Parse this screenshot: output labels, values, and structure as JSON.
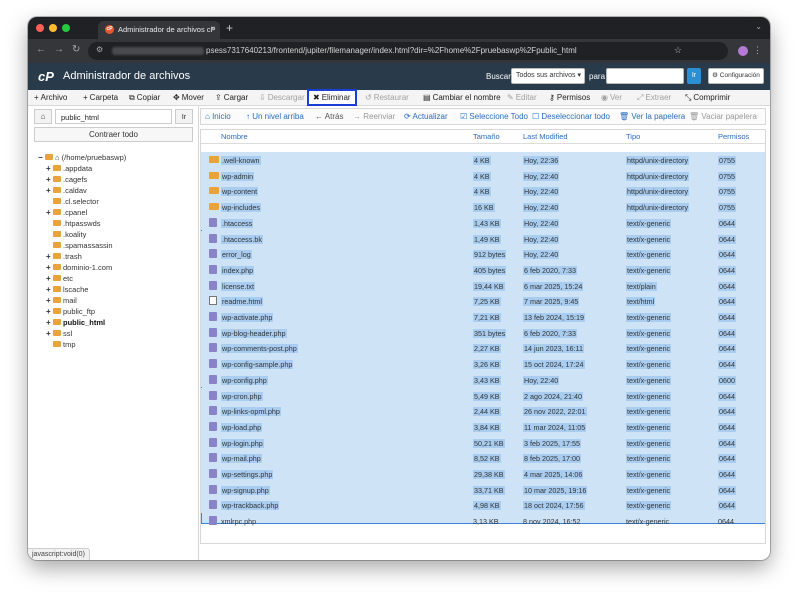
{
  "browser": {
    "tab_title": "Administrador de archivos cP",
    "url_text": "psess7317640213/frontend/jupiter/filemanager/index.html?dir=%2Fhome%2Fpruebaswp%2Fpublic_html",
    "newtab_label": "+",
    "tab_close": "×"
  },
  "header": {
    "logo": "cP",
    "title": "Administrador de archivos",
    "search_label": "Buscar",
    "search_scope": "Todos sus archivos",
    "for_label": "para",
    "search_value": "",
    "go_label": "Ir",
    "settings_label": "Configuración"
  },
  "toolbar": {
    "items": [
      {
        "label": "Archivo",
        "icon": "plus-icon",
        "glyph": "+"
      },
      {
        "label": "Carpeta",
        "icon": "plus-icon",
        "glyph": "+"
      },
      {
        "label": "Copiar",
        "icon": "copy-icon",
        "glyph": "⧉"
      },
      {
        "label": "Mover",
        "icon": "move-icon",
        "glyph": "✥"
      },
      {
        "label": "Cargar",
        "icon": "upload-icon",
        "glyph": "⇪"
      },
      {
        "label": "Descargar",
        "icon": "download-icon",
        "glyph": "⇩"
      },
      {
        "label": "Eliminar",
        "icon": "delete-icon",
        "glyph": "✖"
      },
      {
        "label": "Restaurar",
        "icon": "restore-icon",
        "glyph": "↺"
      },
      {
        "label": "Cambiar el nombre",
        "icon": "rename-icon",
        "glyph": "▤"
      },
      {
        "label": "Editar",
        "icon": "edit-icon",
        "glyph": "✎"
      },
      {
        "label": "Permisos",
        "icon": "key-icon",
        "glyph": "⚷"
      },
      {
        "label": "Ver",
        "icon": "eye-icon",
        "glyph": "◉"
      },
      {
        "label": "Extraer",
        "icon": "extract-icon",
        "glyph": "⤢"
      },
      {
        "label": "Comprimir",
        "icon": "compress-icon",
        "glyph": "⤡"
      }
    ]
  },
  "sidebar": {
    "path_value": "public_html",
    "go_label": "Ir",
    "collapse_label": "Contraer todo",
    "root_label": "(/home/pruebaswp)",
    "tree": [
      {
        "label": ".appdata",
        "expandable": true
      },
      {
        "label": ".cagefs",
        "expandable": true
      },
      {
        "label": ".caldav",
        "expandable": true
      },
      {
        "label": ".cl.selector",
        "expandable": false
      },
      {
        "label": ".cpanel",
        "expandable": true
      },
      {
        "label": ".htpasswds",
        "expandable": false
      },
      {
        "label": ".koality",
        "expandable": false
      },
      {
        "label": ".spamassassin",
        "expandable": false
      },
      {
        "label": ".trash",
        "expandable": true
      },
      {
        "label": "dominio-1.com",
        "expandable": true
      },
      {
        "label": "etc",
        "expandable": true
      },
      {
        "label": "lscache",
        "expandable": true
      },
      {
        "label": "mail",
        "expandable": true
      },
      {
        "label": "public_ftp",
        "expandable": true
      },
      {
        "label": "public_html",
        "expandable": true,
        "bold": true
      },
      {
        "label": "ssl",
        "expandable": true
      },
      {
        "label": "tmp",
        "expandable": false
      }
    ]
  },
  "nav": {
    "items": [
      {
        "label": "Inicio",
        "glyph": "⌂"
      },
      {
        "label": "Un nivel arriba",
        "glyph": "↑"
      },
      {
        "label": "Atrás",
        "glyph": "←"
      },
      {
        "label": "Reenviar",
        "glyph": "→"
      },
      {
        "label": "Actualizar",
        "glyph": "⟳"
      },
      {
        "label": "Seleccione Todo",
        "glyph": "☑"
      },
      {
        "label": "Deseleccionar todo",
        "glyph": "☐"
      },
      {
        "label": "Ver la papelera",
        "glyph": "🗑"
      },
      {
        "label": "Vaciar papelera",
        "glyph": "🗑"
      }
    ]
  },
  "listing": {
    "columns": [
      "Nombre",
      "Tamaño",
      "Last Modified",
      "Tipo",
      "Permisos"
    ],
    "rows": [
      {
        "name": ".well-known",
        "size": "4 KB",
        "modified": "Hoy, 22:36",
        "type": "httpd/unix-directory",
        "perms": "0755",
        "kind": "folder"
      },
      {
        "name": "wp-admin",
        "size": "4 KB",
        "modified": "Hoy, 22:40",
        "type": "httpd/unix-directory",
        "perms": "0755",
        "kind": "folder"
      },
      {
        "name": "wp-content",
        "size": "4 KB",
        "modified": "Hoy, 22:40",
        "type": "httpd/unix-directory",
        "perms": "0755",
        "kind": "folder"
      },
      {
        "name": "wp-includes",
        "size": "16 KB",
        "modified": "Hoy, 22:40",
        "type": "httpd/unix-directory",
        "perms": "0755",
        "kind": "folder"
      },
      {
        "name": ".htaccess",
        "size": "1,43 KB",
        "modified": "Hoy, 22:40",
        "type": "text/x-generic",
        "perms": "0644",
        "kind": "file"
      },
      {
        "name": ".htaccess.bk",
        "size": "1,49 KB",
        "modified": "Hoy, 22:40",
        "type": "text/x-generic",
        "perms": "0644",
        "kind": "file"
      },
      {
        "name": "error_log",
        "size": "912 bytes",
        "modified": "Hoy, 22:40",
        "type": "text/x-generic",
        "perms": "0644",
        "kind": "file"
      },
      {
        "name": "index.php",
        "size": "405 bytes",
        "modified": "6 feb 2020, 7:33",
        "type": "text/x-generic",
        "perms": "0644",
        "kind": "file"
      },
      {
        "name": "license.txt",
        "size": "19,44 KB",
        "modified": "6 mar 2025, 15:24",
        "type": "text/plain",
        "perms": "0644",
        "kind": "file"
      },
      {
        "name": "readme.html",
        "size": "7,25 KB",
        "modified": "7 mar 2025, 9:45",
        "type": "text/html",
        "perms": "0644",
        "kind": "html"
      },
      {
        "name": "wp-activate.php",
        "size": "7,21 KB",
        "modified": "13 feb 2024, 15:19",
        "type": "text/x-generic",
        "perms": "0644",
        "kind": "file"
      },
      {
        "name": "wp-blog-header.php",
        "size": "351 bytes",
        "modified": "6 feb 2020, 7:33",
        "type": "text/x-generic",
        "perms": "0644",
        "kind": "file"
      },
      {
        "name": "wp-comments-post.php",
        "size": "2,27 KB",
        "modified": "14 jun 2023, 16:11",
        "type": "text/x-generic",
        "perms": "0644",
        "kind": "file"
      },
      {
        "name": "wp-config-sample.php",
        "size": "3,26 KB",
        "modified": "15 oct 2024, 17:24",
        "type": "text/x-generic",
        "perms": "0644",
        "kind": "file"
      },
      {
        "name": "wp-config.php",
        "size": "3,43 KB",
        "modified": "Hoy, 22:40",
        "type": "text/x-generic",
        "perms": "0600",
        "kind": "file"
      },
      {
        "name": "wp-cron.php",
        "size": "5,49 KB",
        "modified": "2 ago 2024, 21:40",
        "type": "text/x-generic",
        "perms": "0644",
        "kind": "file"
      },
      {
        "name": "wp-links-opml.php",
        "size": "2,44 KB",
        "modified": "26 nov 2022, 22:01",
        "type": "text/x-generic",
        "perms": "0644",
        "kind": "file"
      },
      {
        "name": "wp-load.php",
        "size": "3,84 KB",
        "modified": "11 mar 2024, 11:05",
        "type": "text/x-generic",
        "perms": "0644",
        "kind": "file"
      },
      {
        "name": "wp-login.php",
        "size": "50,21 KB",
        "modified": "3 feb 2025, 17:55",
        "type": "text/x-generic",
        "perms": "0644",
        "kind": "file"
      },
      {
        "name": "wp-mail.php",
        "size": "8,52 KB",
        "modified": "8 feb 2025, 17:00",
        "type": "text/x-generic",
        "perms": "0644",
        "kind": "file"
      },
      {
        "name": "wp-settings.php",
        "size": "29,38 KB",
        "modified": "4 mar 2025, 14:06",
        "type": "text/x-generic",
        "perms": "0644",
        "kind": "file"
      },
      {
        "name": "wp-signup.php",
        "size": "33,71 KB",
        "modified": "10 mar 2025, 19:16",
        "type": "text/x-generic",
        "perms": "0644",
        "kind": "file"
      },
      {
        "name": "wp-trackback.php",
        "size": "4,98 KB",
        "modified": "18 oct 2024, 17:56",
        "type": "text/x-generic",
        "perms": "0644",
        "kind": "file"
      },
      {
        "name": "xmlrpc.php",
        "size": "3,13 KB",
        "modified": "8 nov 2024, 16:52",
        "type": "text/x-generic",
        "perms": "0644",
        "kind": "file"
      }
    ]
  },
  "statusbar": {
    "text": "javascript:void(0)"
  },
  "colors": {
    "header_bg": "#293a4a",
    "selection_bg": "#cfe3f7",
    "selection_border": "#3a86d4",
    "link": "#2a6cbf",
    "delete_highlight": "#1a3fd6",
    "folder": "#e8a33b"
  }
}
